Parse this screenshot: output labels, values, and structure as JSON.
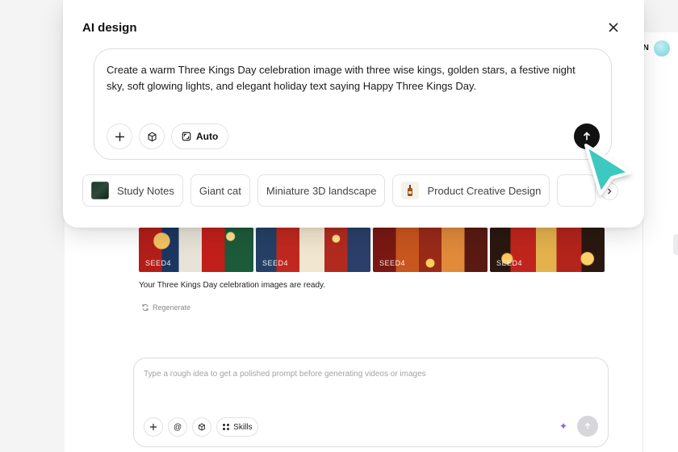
{
  "background": {
    "language": "EN",
    "results": {
      "images": [
        {
          "tag": "SEED4"
        },
        {
          "tag": "SEED4"
        },
        {
          "tag": "SEED4"
        },
        {
          "tag": "SEED4"
        }
      ],
      "message": "Your Three Kings Day celebration images are ready.",
      "regenerate_label": "Regenerate"
    },
    "composer": {
      "placeholder": "Type a rough idea to get a polished prompt before generating videos or images",
      "skills_label": "Skills"
    }
  },
  "modal": {
    "title": "AI design",
    "prompt": "Create a warm Three Kings Day celebration image with three wise kings, golden stars, a festive night sky, soft glowing lights, and elegant holiday text saying Happy Three Kings Day.",
    "auto_label": "Auto",
    "suggestions": [
      {
        "label": "Study Notes"
      },
      {
        "label": "Giant cat"
      },
      {
        "label": "Miniature 3D landscape"
      },
      {
        "label": "Product Creative Design"
      }
    ]
  },
  "colors": {
    "accent_cursor": "#3cc9c0",
    "sparkle": "#8b5cf6"
  }
}
